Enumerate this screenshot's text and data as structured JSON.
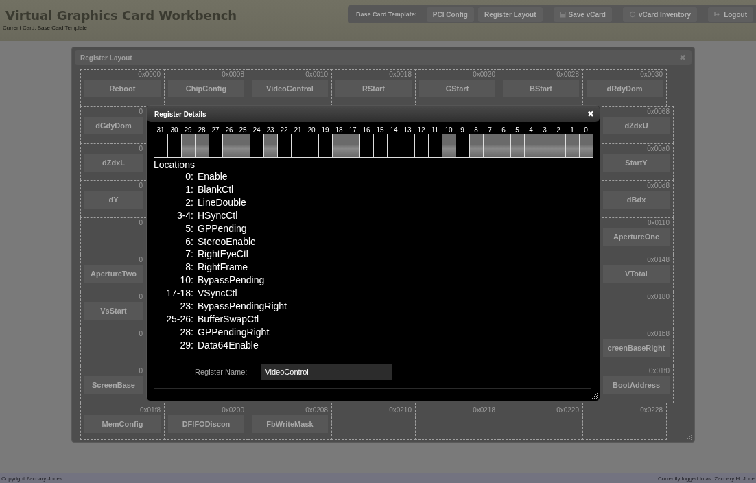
{
  "header": {
    "title": "Virtual Graphics Card Workbench",
    "subtitle": "Current Card: Base Card Template",
    "nav": [
      {
        "kind": "label",
        "label": "Base Card Template:"
      },
      {
        "kind": "button",
        "label": "PCI Config"
      },
      {
        "kind": "button",
        "label": "Register Layout"
      },
      {
        "kind": "save",
        "label": "Save vCard"
      },
      {
        "kind": "refresh",
        "label": "vCard Inventory"
      },
      {
        "kind": "logout",
        "label": "Logout"
      }
    ]
  },
  "panel": {
    "title": "Register Layout",
    "close": "✖",
    "rows": [
      {
        "kind": "full",
        "cells": [
          {
            "address": "0x0000",
            "label": "Reboot"
          },
          {
            "address": "0x0008",
            "label": "ChipConfig"
          },
          {
            "address": "0x0010",
            "label": "VideoControl"
          },
          {
            "address": "0x0018",
            "label": "RStart"
          },
          {
            "address": "0x0020",
            "label": "GStart"
          },
          {
            "address": "0x0028",
            "label": "BStart"
          },
          {
            "address": "0x0030",
            "label": "dRdyDom"
          }
        ]
      },
      {
        "kind": "split",
        "cells": [
          {
            "address": "0",
            "label": "dGdyDom"
          },
          {
            "address": "0x0068",
            "label": "dZdxU"
          }
        ]
      },
      {
        "kind": "split",
        "cells": [
          {
            "address": "0",
            "label": "dZdxL"
          },
          {
            "address": "0x00a0",
            "label": "StartY"
          }
        ]
      },
      {
        "kind": "split",
        "cells": [
          {
            "address": "0",
            "label": "dY"
          },
          {
            "address": "0x00d8",
            "label": "dBdx"
          }
        ]
      },
      {
        "kind": "split",
        "cells": [
          {
            "address": "0"
          },
          {
            "address": "0x0110",
            "label": "ApertureOne"
          }
        ]
      },
      {
        "kind": "split",
        "cells": [
          {
            "address": "0",
            "label": "ApertureTwo"
          },
          {
            "address": "0x0148",
            "label": "VTotal"
          }
        ]
      },
      {
        "kind": "split",
        "cells": [
          {
            "address": "0",
            "label": "VsStart"
          },
          {
            "address": "0x0180"
          }
        ]
      },
      {
        "kind": "split",
        "cells": [
          {
            "address": "0"
          },
          {
            "address": "0x01b8",
            "label": "creenBaseRight"
          }
        ]
      },
      {
        "kind": "split",
        "cells": [
          {
            "address": "0",
            "label": "ScreenBase"
          },
          {
            "address": "0x01f0",
            "label": "BootAddress"
          }
        ]
      },
      {
        "kind": "full",
        "cells": [
          {
            "address": "0x01f8",
            "label": "MemConfig"
          },
          {
            "address": "0x0200",
            "label": "DFIFODiscon"
          },
          {
            "address": "0x0208",
            "label": "FbWriteMask"
          },
          {
            "address": "0x0210"
          },
          {
            "address": "0x0218"
          },
          {
            "address": "0x0220"
          },
          {
            "address": "0x0228"
          }
        ]
      }
    ]
  },
  "dialog": {
    "title": "Register Details",
    "close": "✖",
    "bit_numbers": [
      "31",
      "30",
      "29",
      "28",
      "27",
      "26",
      "25",
      "24",
      "23",
      "22",
      "21",
      "20",
      "19",
      "18",
      "17",
      "16",
      "15",
      "14",
      "13",
      "12",
      "11",
      "10",
      "9",
      "8",
      "7",
      "6",
      "5",
      "4",
      "3",
      "2",
      "1",
      "0"
    ],
    "bit_cells": [
      {
        "kind": "reserved",
        "wide": false
      },
      {
        "kind": "reserved",
        "wide": false
      },
      {
        "kind": "field",
        "wide": false
      },
      {
        "kind": "field",
        "wide": false
      },
      {
        "kind": "reserved",
        "wide": false
      },
      {
        "kind": "field",
        "wide": true
      },
      {
        "kind": "reserved",
        "wide": false
      },
      {
        "kind": "field",
        "wide": false
      },
      {
        "kind": "reserved",
        "wide": false
      },
      {
        "kind": "reserved",
        "wide": false
      },
      {
        "kind": "reserved",
        "wide": false
      },
      {
        "kind": "reserved",
        "wide": false
      },
      {
        "kind": "field",
        "wide": true
      },
      {
        "kind": "reserved",
        "wide": false
      },
      {
        "kind": "reserved",
        "wide": false
      },
      {
        "kind": "reserved",
        "wide": false
      },
      {
        "kind": "reserved",
        "wide": false
      },
      {
        "kind": "reserved",
        "wide": false
      },
      {
        "kind": "reserved",
        "wide": false
      },
      {
        "kind": "field",
        "wide": false
      },
      {
        "kind": "reserved",
        "wide": false
      },
      {
        "kind": "field",
        "wide": false
      },
      {
        "kind": "field",
        "wide": false
      },
      {
        "kind": "field",
        "wide": false
      },
      {
        "kind": "field",
        "wide": false
      },
      {
        "kind": "field",
        "wide": true
      },
      {
        "kind": "field",
        "wide": false
      },
      {
        "kind": "field",
        "wide": false
      },
      {
        "kind": "field",
        "wide": false
      }
    ],
    "locations_title": "Locations",
    "locations": [
      {
        "bits": "0:",
        "name": "Enable"
      },
      {
        "bits": "1:",
        "name": "BlankCtl"
      },
      {
        "bits": "2:",
        "name": "LineDouble"
      },
      {
        "bits": "3-4:",
        "name": "HSyncCtl"
      },
      {
        "bits": "5:",
        "name": "GPPending"
      },
      {
        "bits": "6:",
        "name": "StereoEnable"
      },
      {
        "bits": "7:",
        "name": "RightEyeCtl"
      },
      {
        "bits": "8:",
        "name": "RightFrame"
      },
      {
        "bits": "10:",
        "name": "BypassPending"
      },
      {
        "bits": "17-18:",
        "name": "VSyncCtl"
      },
      {
        "bits": "23:",
        "name": "BypassPendingRight"
      },
      {
        "bits": "25-26:",
        "name": "BufferSwapCtl"
      },
      {
        "bits": "28:",
        "name": "GPPendingRight"
      },
      {
        "bits": "29:",
        "name": "Data64Enable"
      }
    ],
    "name_label": "Register Name:",
    "name_value": "VideoControl"
  },
  "footer": {
    "left": "Copyright Zachary Jones",
    "right": "Currently logged in as: Zachary H. Jone"
  }
}
